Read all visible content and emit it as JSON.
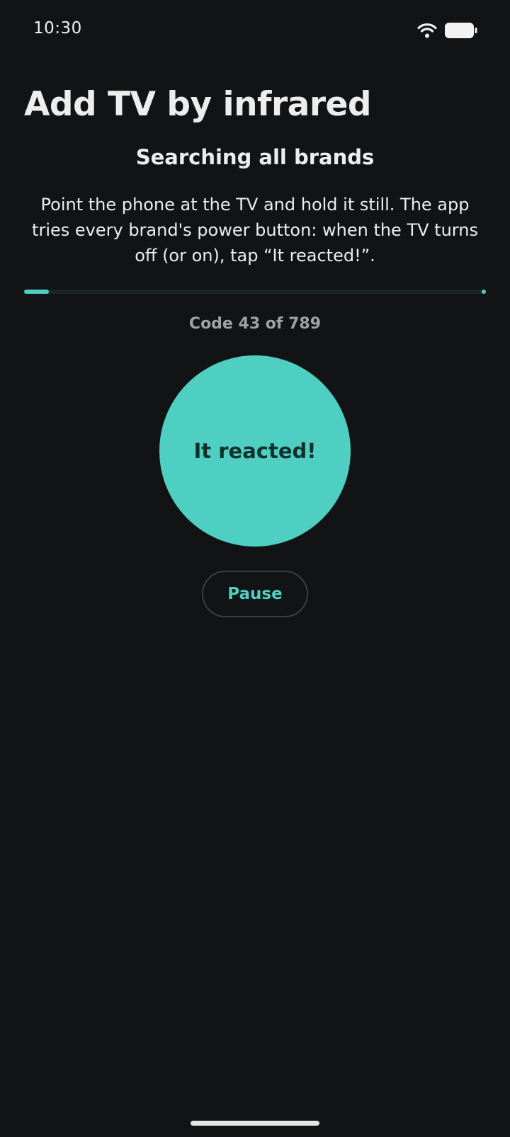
{
  "status_bar": {
    "time": "10:30",
    "wifi_icon": "wifi-icon",
    "battery_icon": "battery-icon"
  },
  "header": {
    "title": "Add TV by infrared"
  },
  "search": {
    "section_title": "Searching all brands",
    "instructions": "Point the phone at the TV and hold it still. The app tries every brand's power button: when the TV turns off (or on), tap “It reacted!”.",
    "progress_fraction": 0.0545,
    "code_counter": "Code 43 of 789"
  },
  "actions": {
    "reacted_label": "It reacted!",
    "pause_label": "Pause"
  },
  "colors": {
    "background": "#111315",
    "accent": "#4ECFC2",
    "text_primary": "#EDEDED",
    "text_muted": "#9DA3A3"
  }
}
